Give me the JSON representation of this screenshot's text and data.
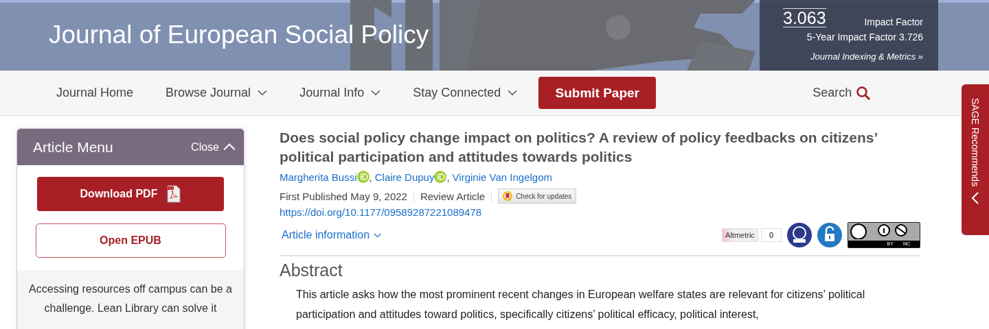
{
  "header": {
    "journal_title": "Journal of European Social Policy",
    "metrics": {
      "impact_value": "3.063",
      "impact_label": "Impact Factor",
      "five_year": "5-Year Impact Factor 3.726",
      "link": "Journal Indexing & Metrics »"
    }
  },
  "nav": {
    "items": [
      {
        "label": "Journal Home",
        "dropdown": false
      },
      {
        "label": "Browse Journal",
        "dropdown": true
      },
      {
        "label": "Journal Info",
        "dropdown": true
      },
      {
        "label": "Stay Connected",
        "dropdown": true
      }
    ],
    "submit": "Submit Paper",
    "search": "Search"
  },
  "article_menu": {
    "title": "Article Menu",
    "close": "Close",
    "expanded": true,
    "download": "Download PDF",
    "epub": "Open EPUB",
    "lean_library": "Accessing resources off campus can be a challenge. Lean Library can solve it"
  },
  "article": {
    "title": "Does social policy change impact on politics? A review of policy feedbacks on citizens’ political participation and attitudes towards politics",
    "authors": [
      {
        "name": "Margherita Bussi",
        "orcid": true
      },
      {
        "name": "Claire Dupuy",
        "orcid": true
      },
      {
        "name": "Virginie Van Ingelgom",
        "orcid": false
      }
    ],
    "author_separator": ",",
    "published": "First Published May 9, 2022",
    "type": "Review Article",
    "check_updates": "Check for updates",
    "doi": "https://doi.org/10.1177/09589287221089478",
    "info": "Article information",
    "altmetric": {
      "label": "Altmetric",
      "count": "0"
    },
    "license": {
      "by": "BY",
      "nc": "NC"
    },
    "abstract_heading": "Abstract",
    "abstract": "This article asks how the most prominent recent changes in European welfare states are relevant for citizens’ political participation and attitudes toward politics, specifically citizens’ political efficacy, political interest,"
  },
  "side_tab": {
    "label": "SAGE Recommends"
  }
}
